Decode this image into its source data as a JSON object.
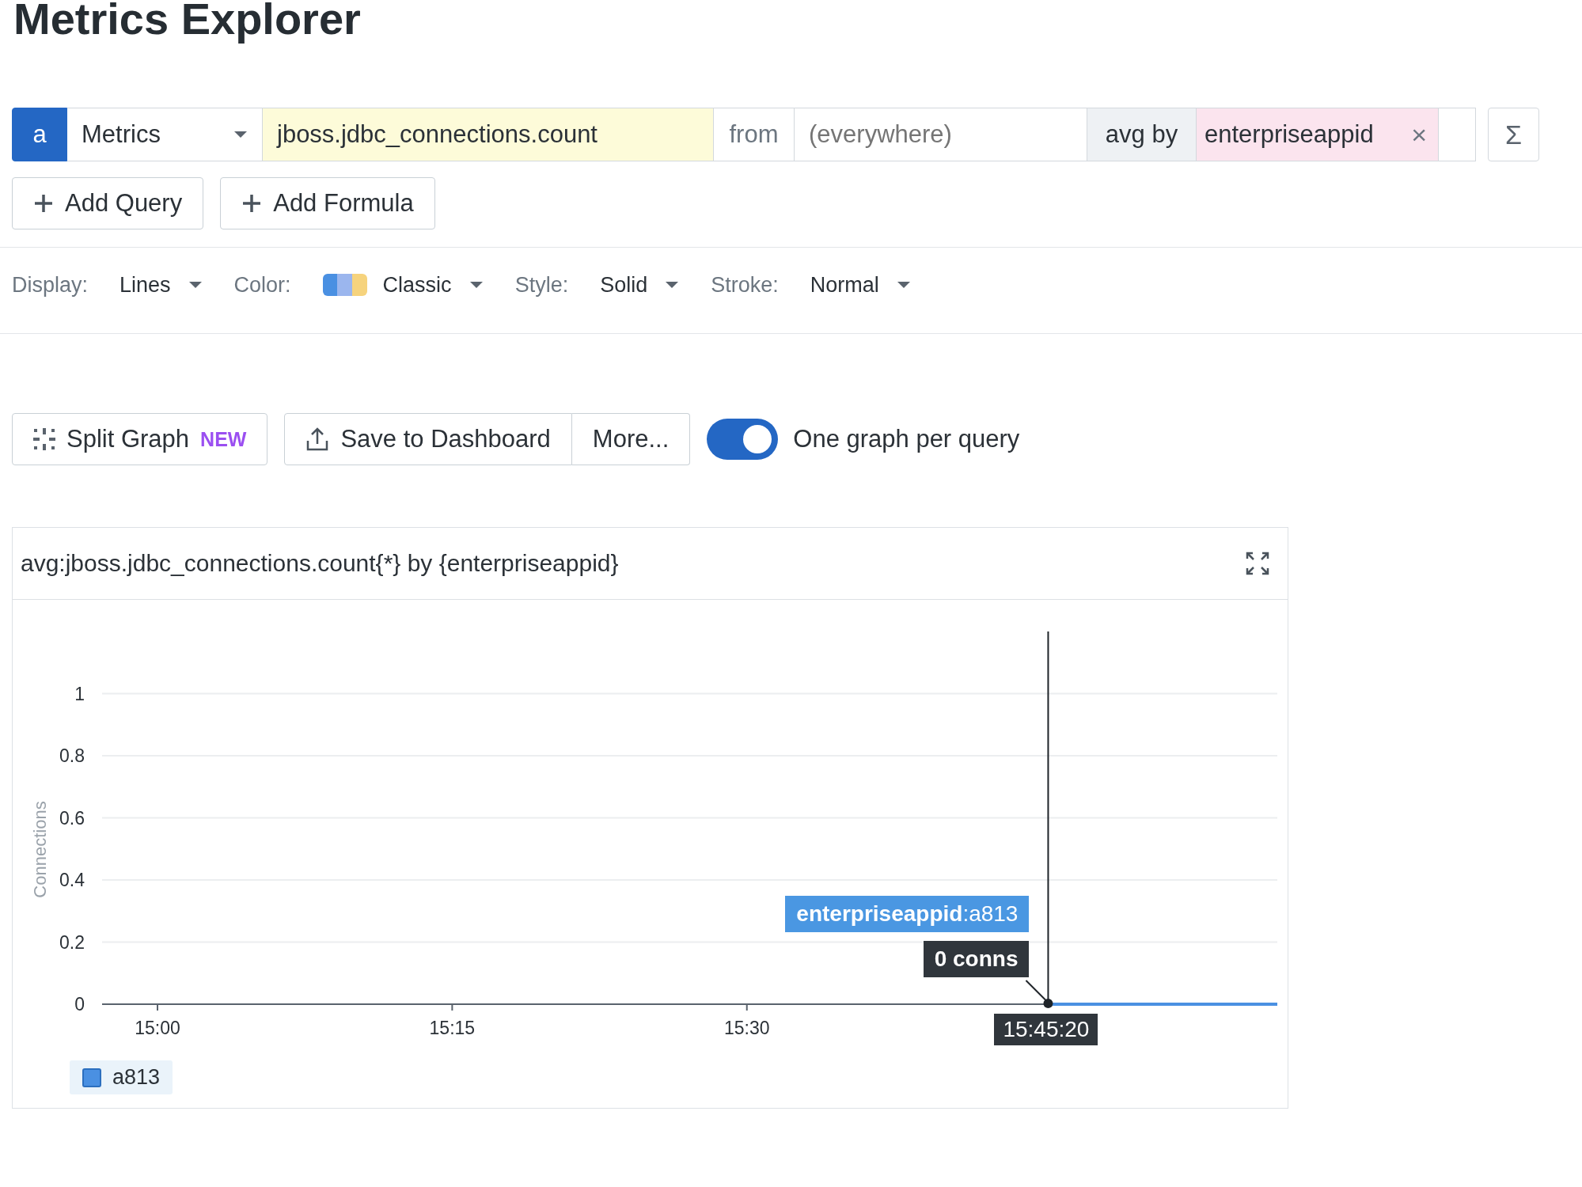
{
  "page": {
    "title": "Metrics Explorer"
  },
  "query": {
    "letter": "a",
    "source": "Metrics",
    "metric": "jboss.jdbc_connections.count",
    "from_label": "from",
    "scope_placeholder": "(everywhere)",
    "aggregation_label": "avg by",
    "group_tags": [
      {
        "label": "enterpriseappid",
        "remove": "×"
      }
    ],
    "function_button": "Σ"
  },
  "add_buttons": [
    {
      "label": "Add Query"
    },
    {
      "label": "Add Formula"
    }
  ],
  "options": [
    {
      "label": "Display:",
      "value": "Lines",
      "kind": "plain"
    },
    {
      "label": "Color:",
      "value": "Classic",
      "kind": "palette"
    },
    {
      "label": "Style:",
      "value": "Solid",
      "kind": "plain"
    },
    {
      "label": "Stroke:",
      "value": "Normal",
      "kind": "plain"
    }
  ],
  "actions": {
    "split_graph": {
      "label": "Split Graph",
      "badge": "NEW"
    },
    "save": {
      "label": "Save to Dashboard"
    },
    "more": {
      "label": "More..."
    },
    "toggle": {
      "label": "One graph per query",
      "on": true
    }
  },
  "graph": {
    "title": "avg:jboss.jdbc_connections.count{*} by {enterpriseappid}",
    "chart_data": {
      "type": "line",
      "ylabel": "Connections",
      "x": [
        15.7556,
        15.95
      ],
      "series": [
        {
          "name": "a813",
          "color": "#4a90e2",
          "values": [
            0,
            0
          ]
        }
      ],
      "xlim": [
        14.953,
        15.95
      ],
      "ylim": [
        0,
        1.2
      ],
      "grid": true,
      "xticks": [
        {
          "value": 15,
          "label": "15:00"
        },
        {
          "value": 15.25,
          "label": "15:15"
        },
        {
          "value": 15.5,
          "label": "15:30"
        }
      ],
      "annotations": [
        {
          "x": 15.7556,
          "text": "15:45:20"
        }
      ],
      "yticks": [
        {
          "value": 0,
          "label": "0"
        },
        {
          "value": 0.2,
          "label": "0.2"
        },
        {
          "value": 0.4,
          "label": "0.4"
        },
        {
          "value": 0.6,
          "label": "0.6"
        },
        {
          "value": 0.8,
          "label": "0.8"
        },
        {
          "value": 1,
          "label": "1"
        }
      ]
    },
    "tooltip": {
      "series": "**enterpriseappid**:a813",
      "value": "0 conns"
    }
  }
}
